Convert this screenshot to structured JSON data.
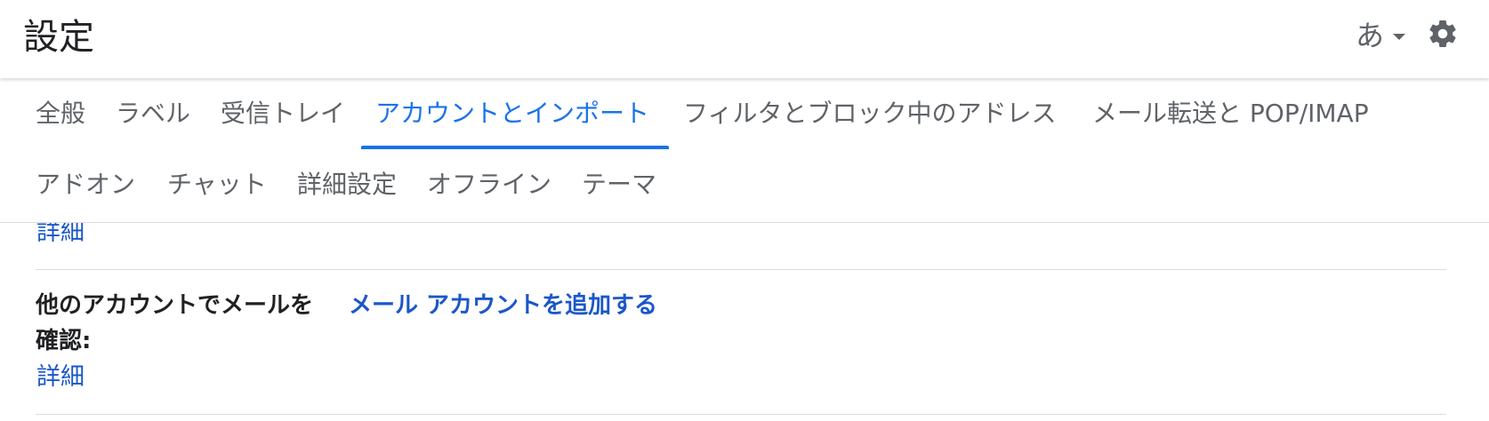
{
  "header": {
    "title": "設定",
    "ime_label": "あ",
    "icons": {
      "ime_menu": "chevron-down-icon",
      "settings": "gear-icon"
    }
  },
  "tabs": {
    "row1": [
      {
        "label": "全般"
      },
      {
        "label": "ラベル"
      },
      {
        "label": "受信トレイ"
      },
      {
        "label": "アカウントとインポート",
        "active": true
      },
      {
        "label": "フィルタとブロック中のアドレス"
      },
      {
        "label": "メール転送と POP/IMAP"
      }
    ],
    "row2": [
      {
        "label": "アドオン"
      },
      {
        "label": "チャット"
      },
      {
        "label": "詳細設定"
      },
      {
        "label": "オフライン"
      },
      {
        "label": "テーマ"
      }
    ]
  },
  "content": {
    "top_detail_link": "詳細",
    "check_mail": {
      "label_line1": "他のアカウントでメールを",
      "label_line2": "確認:",
      "action_link": "メール アカウントを追加する",
      "detail_link": "詳細"
    }
  },
  "colors": {
    "accent": "#1a73e8",
    "link": "#1a57c9",
    "text": "#202124",
    "muted": "#5f6368",
    "divider": "#dadce0"
  }
}
